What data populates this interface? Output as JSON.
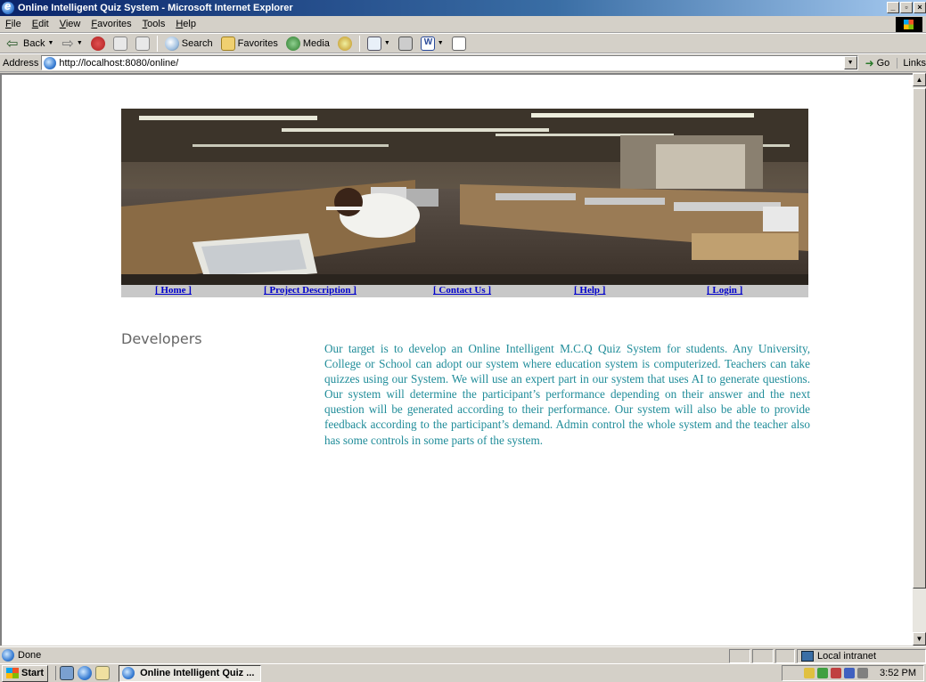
{
  "window": {
    "title": "Online Intelligent Quiz System - Microsoft Internet Explorer",
    "buttons": [
      "_",
      "▫",
      "×"
    ]
  },
  "menu": [
    "File",
    "Edit",
    "View",
    "Favorites",
    "Tools",
    "Help"
  ],
  "toolbar": {
    "back_label": "Back",
    "search_label": "Search",
    "favorites_label": "Favorites",
    "media_label": "Media"
  },
  "address": {
    "label": "Address",
    "url": "http://localhost:8080/online/",
    "go_label": "Go",
    "links_label": "Links"
  },
  "page": {
    "nav": [
      {
        "label": "[ Home ]"
      },
      {
        "label": "[ Project Description ]"
      },
      {
        "label": "[ Contact Us ]"
      },
      {
        "label": "[ Help ]"
      },
      {
        "label": "[ Login ]"
      }
    ],
    "heading": "Developers",
    "description": "Our target is to develop an Online Intelligent M.C.Q Quiz System for students. Any University, College or School can adopt our system where education system is computerized. Teachers can take quizzes using our System. We will use an expert part in our system that uses AI to generate questions. Our system will determine the participant’s performance depending on their answer and the next question will be generated according to their performance. Our system will also be able to provide feedback according to the participant’s demand. Admin control the whole system and the teacher also has some controls in some parts of the system."
  },
  "status": {
    "text": "Done",
    "zone": "Local intranet"
  },
  "taskbar": {
    "start_label": "Start",
    "task_label": "Online Intelligent Quiz ...",
    "clock": "3:52 PM"
  }
}
